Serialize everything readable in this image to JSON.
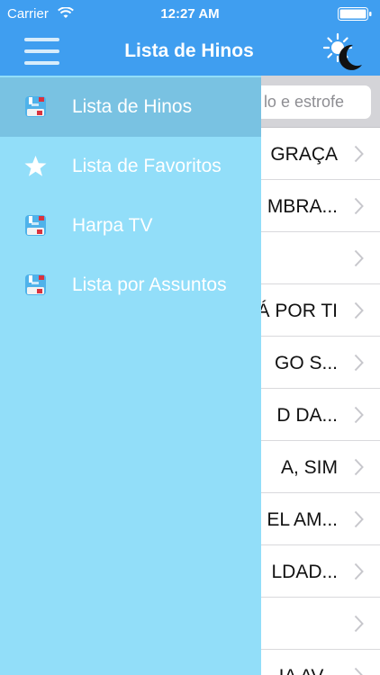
{
  "status_bar": {
    "carrier": "Carrier",
    "time": "12:27 AM"
  },
  "header": {
    "title": "Lista de Hinos"
  },
  "search": {
    "placeholder": "lo e estrofe"
  },
  "drawer": {
    "items": [
      {
        "label": "Lista de Hinos",
        "icon": "hymnbook-icon",
        "active": true
      },
      {
        "label": "Lista de Favoritos",
        "icon": "star-icon",
        "active": false
      },
      {
        "label": "Harpa TV",
        "icon": "hymnbook-icon",
        "active": false
      },
      {
        "label": "Lista por Assuntos",
        "icon": "hymnbook-icon",
        "active": false
      }
    ]
  },
  "list": {
    "rows": [
      {
        "title": "GRAÇA"
      },
      {
        "title": "MBRA..."
      },
      {
        "title": ""
      },
      {
        "title": "Á POR TI"
      },
      {
        "title": "GO S..."
      },
      {
        "title": "D DA..."
      },
      {
        "title": "A, SIM"
      },
      {
        "title": "EL AM..."
      },
      {
        "title": "LDAD..."
      },
      {
        "title": ""
      },
      {
        "title": "IA AV..."
      }
    ]
  },
  "colors": {
    "header_blue": "#3f9ef0",
    "drawer_blue": "#92def9",
    "active_item": "#79c2e2"
  }
}
